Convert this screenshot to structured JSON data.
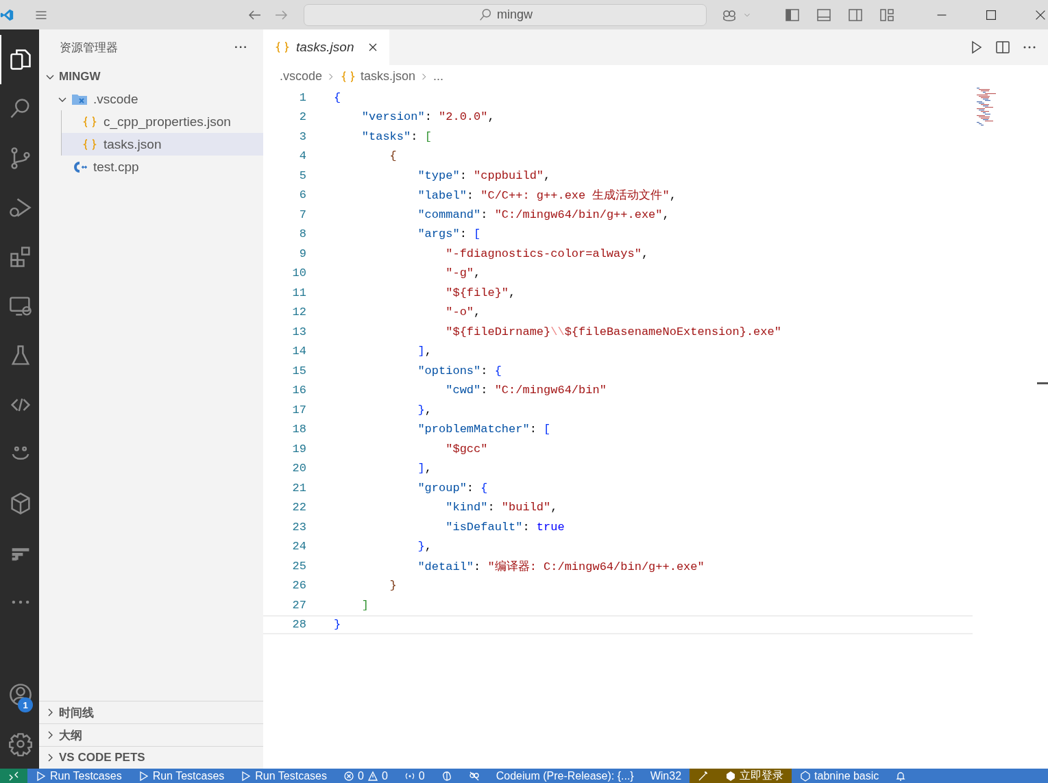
{
  "titlebar": {
    "search": "mingw"
  },
  "activity": [
    {
      "kind": "files",
      "selected": true
    },
    {
      "kind": "search",
      "selected": false
    },
    {
      "kind": "branch",
      "selected": false
    },
    {
      "kind": "debug",
      "selected": false
    },
    {
      "kind": "extensions",
      "selected": false
    },
    {
      "kind": "remote",
      "selected": false
    },
    {
      "kind": "flask",
      "selected": false
    },
    {
      "kind": "share",
      "selected": false
    },
    {
      "kind": "smile",
      "selected": false
    },
    {
      "kind": "cube",
      "selected": false
    },
    {
      "kind": "blocks",
      "selected": false
    },
    {
      "kind": "more",
      "selected": false
    }
  ],
  "account_badge": "1",
  "sidebar": {
    "title": "资源管理器",
    "more": "···",
    "tree": [
      {
        "label": "MINGW",
        "expanded": true,
        "selected": false,
        "children": [
          {
            "label": ".vscode",
            "kind": "folder",
            "expanded": true,
            "selected": false,
            "children": [
              {
                "label": "c_cpp_properties.json",
                "kind": "json",
                "selected": false
              },
              {
                "label": "tasks.json",
                "kind": "json",
                "selected": true
              }
            ]
          },
          {
            "label": "test.cpp",
            "kind": "cpp",
            "selected": false
          }
        ]
      }
    ],
    "panels": [
      {
        "label": "时间线",
        "expanded": false
      },
      {
        "label": "大纲",
        "expanded": false
      },
      {
        "label": "VS CODE PETS",
        "expanded": false
      }
    ]
  },
  "tabs": [
    {
      "label": "tasks.json",
      "selected": true
    }
  ],
  "breadcrumb": [
    ".vscode",
    "tasks.json",
    "..."
  ],
  "code": [
    {
      "n": "1",
      "current": false,
      "t": [
        {
          "kind": "b1",
          "text": "{"
        }
      ]
    },
    {
      "n": "2",
      "current": false,
      "t": [
        {
          "kind": "key",
          "text": "    \"version\""
        },
        {
          "kind": "p",
          "text": ": "
        },
        {
          "kind": "str",
          "text": "\"2.0.0\""
        },
        {
          "kind": "p",
          "text": ","
        }
      ]
    },
    {
      "n": "3",
      "current": false,
      "t": [
        {
          "kind": "key",
          "text": "    \"tasks\""
        },
        {
          "kind": "p",
          "text": ": "
        },
        {
          "kind": "b2",
          "text": "["
        }
      ]
    },
    {
      "n": "4",
      "current": false,
      "t": [
        {
          "kind": "b3",
          "text": "        {"
        }
      ]
    },
    {
      "n": "5",
      "current": false,
      "t": [
        {
          "kind": "key",
          "text": "            \"type\""
        },
        {
          "kind": "p",
          "text": ": "
        },
        {
          "kind": "str",
          "text": "\"cppbuild\""
        },
        {
          "kind": "p",
          "text": ","
        }
      ]
    },
    {
      "n": "6",
      "current": false,
      "t": [
        {
          "kind": "key",
          "text": "            \"label\""
        },
        {
          "kind": "p",
          "text": ": "
        },
        {
          "kind": "str",
          "text": "\"C/C++: g++.exe 生成活动文件\""
        },
        {
          "kind": "p",
          "text": ","
        }
      ]
    },
    {
      "n": "7",
      "current": false,
      "t": [
        {
          "kind": "key",
          "text": "            \"command\""
        },
        {
          "kind": "p",
          "text": ": "
        },
        {
          "kind": "str",
          "text": "\"C:/mingw64/bin/g++.exe\""
        },
        {
          "kind": "p",
          "text": ","
        }
      ]
    },
    {
      "n": "8",
      "current": false,
      "t": [
        {
          "kind": "key",
          "text": "            \"args\""
        },
        {
          "kind": "p",
          "text": ": "
        },
        {
          "kind": "b1",
          "text": "["
        }
      ]
    },
    {
      "n": "9",
      "current": false,
      "t": [
        {
          "kind": "str",
          "text": "                \"-fdiagnostics-color=always\""
        },
        {
          "kind": "p",
          "text": ","
        }
      ]
    },
    {
      "n": "10",
      "current": false,
      "t": [
        {
          "kind": "str",
          "text": "                \"-g\""
        },
        {
          "kind": "p",
          "text": ","
        }
      ]
    },
    {
      "n": "11",
      "current": false,
      "t": [
        {
          "kind": "str",
          "text": "                \"${file}\""
        },
        {
          "kind": "p",
          "text": ","
        }
      ]
    },
    {
      "n": "12",
      "current": false,
      "t": [
        {
          "kind": "str",
          "text": "                \"-o\""
        },
        {
          "kind": "p",
          "text": ","
        }
      ]
    },
    {
      "n": "13",
      "current": false,
      "t": [
        {
          "kind": "str",
          "text": "                \"${fileDirname}"
        },
        {
          "kind": "esc",
          "text": "\\\\"
        },
        {
          "kind": "str",
          "text": "${fileBasenameNoExtension}.exe\""
        }
      ]
    },
    {
      "n": "14",
      "current": false,
      "t": [
        {
          "kind": "b1",
          "text": "            ]"
        },
        {
          "kind": "p",
          "text": ","
        }
      ]
    },
    {
      "n": "15",
      "current": false,
      "t": [
        {
          "kind": "key",
          "text": "            \"options\""
        },
        {
          "kind": "p",
          "text": ": "
        },
        {
          "kind": "b1",
          "text": "{"
        }
      ]
    },
    {
      "n": "16",
      "current": false,
      "t": [
        {
          "kind": "key",
          "text": "                \"cwd\""
        },
        {
          "kind": "p",
          "text": ": "
        },
        {
          "kind": "str",
          "text": "\"C:/mingw64/bin\""
        }
      ]
    },
    {
      "n": "17",
      "current": false,
      "t": [
        {
          "kind": "b1",
          "text": "            }"
        },
        {
          "kind": "p",
          "text": ","
        }
      ]
    },
    {
      "n": "18",
      "current": false,
      "t": [
        {
          "kind": "key",
          "text": "            \"problemMatcher\""
        },
        {
          "kind": "p",
          "text": ": "
        },
        {
          "kind": "b1",
          "text": "["
        }
      ]
    },
    {
      "n": "19",
      "current": false,
      "t": [
        {
          "kind": "str",
          "text": "                \"$gcc\""
        }
      ]
    },
    {
      "n": "20",
      "current": false,
      "t": [
        {
          "kind": "b1",
          "text": "            ]"
        },
        {
          "kind": "p",
          "text": ","
        }
      ]
    },
    {
      "n": "21",
      "current": false,
      "t": [
        {
          "kind": "key",
          "text": "            \"group\""
        },
        {
          "kind": "p",
          "text": ": "
        },
        {
          "kind": "b1",
          "text": "{"
        }
      ]
    },
    {
      "n": "22",
      "current": false,
      "t": [
        {
          "kind": "key",
          "text": "                \"kind\""
        },
        {
          "kind": "p",
          "text": ": "
        },
        {
          "kind": "str",
          "text": "\"build\""
        },
        {
          "kind": "p",
          "text": ","
        }
      ]
    },
    {
      "n": "23",
      "current": false,
      "t": [
        {
          "kind": "key",
          "text": "                \"isDefault\""
        },
        {
          "kind": "p",
          "text": ": "
        },
        {
          "kind": "kw",
          "text": "true"
        }
      ]
    },
    {
      "n": "24",
      "current": false,
      "t": [
        {
          "kind": "b1",
          "text": "            }"
        },
        {
          "kind": "p",
          "text": ","
        }
      ]
    },
    {
      "n": "25",
      "current": false,
      "t": [
        {
          "kind": "key",
          "text": "            \"detail\""
        },
        {
          "kind": "p",
          "text": ": "
        },
        {
          "kind": "str",
          "text": "\"编译器: C:/mingw64/bin/g++.exe\""
        }
      ]
    },
    {
      "n": "26",
      "current": false,
      "t": [
        {
          "kind": "b3",
          "text": "        }"
        }
      ]
    },
    {
      "n": "27",
      "current": false,
      "t": [
        {
          "kind": "b2",
          "text": "    ]"
        }
      ]
    },
    {
      "n": "28",
      "current": true,
      "t": [
        {
          "kind": "b1",
          "text": "}"
        }
      ]
    }
  ],
  "status_bar": [
    {
      "kind": "remote",
      "color": "#16825d"
    },
    {
      "kind": "run",
      "text": "Run Testcases",
      "color": "#3a78c9"
    },
    {
      "kind": "run",
      "text": "Run Testcases",
      "color": "#3a78c9"
    },
    {
      "kind": "run",
      "text": "Run Testcases",
      "color": "#3a78c9"
    },
    {
      "kind": "problems",
      "text": "0",
      "text2": "0",
      "color": "#3a78c9"
    },
    {
      "kind": "ports",
      "text": "0",
      "color": "#3a78c9"
    },
    {
      "kind": "brain",
      "color": "#3a78c9"
    },
    {
      "kind": "copilot",
      "color": "#3a78c9"
    },
    {
      "kind": "plain",
      "text": "Codeium (Pre-Release): {...}",
      "color": "#3a78c9"
    },
    {
      "kind": "plain",
      "text": "Win32",
      "color": "#3a78c9"
    },
    {
      "kind": "wand",
      "color": "#7a5c00"
    },
    {
      "kind": "login",
      "text": "立即登录",
      "color": "#7a5c00"
    },
    {
      "kind": "tabnine",
      "text": "tabnine basic",
      "color": "#3a78c9"
    },
    {
      "kind": "bell",
      "color": "#3a78c9"
    }
  ]
}
